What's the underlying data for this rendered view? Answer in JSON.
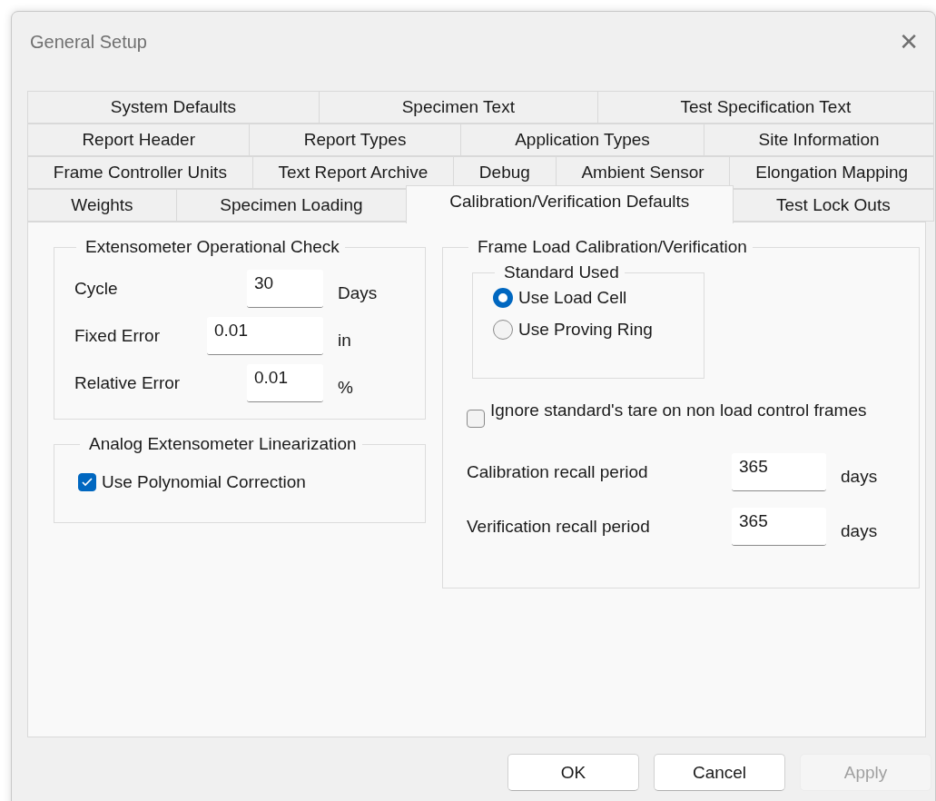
{
  "window": {
    "title": "General Setup",
    "close_label": "✕"
  },
  "tab_rows": [
    {
      "tabs": [
        {
          "label": "System Defaults",
          "selected": false
        },
        {
          "label": "Specimen Text",
          "selected": false
        },
        {
          "label": "Test Specification Text",
          "selected": false
        }
      ]
    },
    {
      "tabs": [
        {
          "label": "Report Header",
          "selected": false
        },
        {
          "label": "Report Types",
          "selected": false
        },
        {
          "label": "Application Types",
          "selected": false
        },
        {
          "label": "Site Information",
          "selected": false
        }
      ]
    },
    {
      "tabs": [
        {
          "label": "Frame Controller Units",
          "selected": false
        },
        {
          "label": "Text Report Archive",
          "selected": false
        },
        {
          "label": "Debug",
          "selected": false
        },
        {
          "label": "Ambient Sensor",
          "selected": false
        },
        {
          "label": "Elongation Mapping",
          "selected": false
        }
      ]
    },
    {
      "tabs": [
        {
          "label": "Weights",
          "selected": false
        },
        {
          "label": "Specimen Loading",
          "selected": false
        },
        {
          "label": "Calibration/Verification Defaults",
          "selected": true
        },
        {
          "label": "Test Lock Outs",
          "selected": false
        }
      ]
    }
  ],
  "extensometer_check": {
    "title": "Extensometer Operational Check",
    "fields": [
      {
        "label": "Cycle",
        "value": "30",
        "unit": "Days",
        "kind": "short"
      },
      {
        "label": "Fixed Error",
        "value": "0.01",
        "unit": "in",
        "kind": "long"
      },
      {
        "label": "Relative Error",
        "value": "0.01",
        "unit": "%",
        "kind": "short"
      }
    ]
  },
  "linearization": {
    "title": "Analog Extensometer Linearization",
    "checkbox": {
      "label": "Use Polynomial Correction",
      "checked": true
    }
  },
  "frame_load": {
    "title": "Frame Load Calibration/Verification",
    "standard_used": {
      "title": "Standard Used",
      "options": [
        {
          "label": "Use Load Cell",
          "selected": true
        },
        {
          "label": "Use Proving Ring",
          "selected": false
        }
      ]
    },
    "checkbox": {
      "label": "Ignore standard's tare on non load control frames",
      "checked": false
    },
    "fields": [
      {
        "label": "Calibration recall period",
        "value": "365",
        "unit": "days"
      },
      {
        "label": "Verification recall period",
        "value": "365",
        "unit": "days"
      }
    ]
  },
  "buttons": [
    {
      "label": "OK",
      "disabled": false
    },
    {
      "label": "Cancel",
      "disabled": false
    },
    {
      "label": "Apply",
      "disabled": true
    }
  ]
}
